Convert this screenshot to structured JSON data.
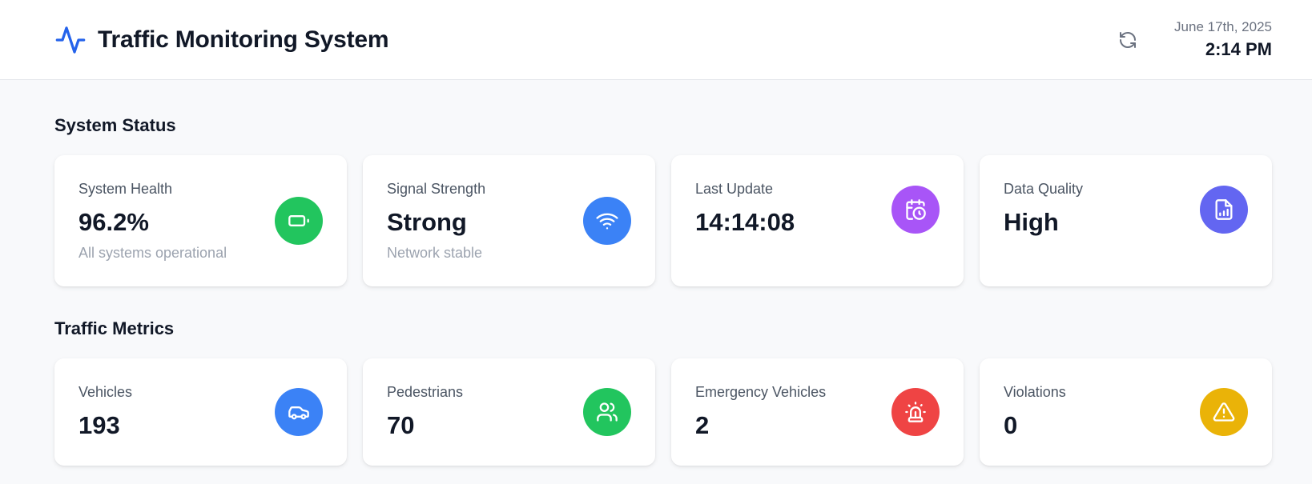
{
  "header": {
    "title": "Traffic Monitoring System",
    "logo_icon": "activity-icon",
    "refresh_icon": "refresh-icon",
    "date": "June 17th, 2025",
    "time": "2:14 PM"
  },
  "system_status": {
    "title": "System Status",
    "cards": [
      {
        "label": "System Health",
        "value": "96.2%",
        "sub": "All systems operational",
        "icon": "battery-icon",
        "color": "#22c55e"
      },
      {
        "label": "Signal Strength",
        "value": "Strong",
        "sub": "Network stable",
        "icon": "wifi-icon",
        "color": "#3b82f6"
      },
      {
        "label": "Last Update",
        "value": "14:14:08",
        "icon": "calendar-clock-icon",
        "color": "#a855f7"
      },
      {
        "label": "Data Quality",
        "value": "High",
        "icon": "file-chart-icon",
        "color": "#6366f1"
      }
    ]
  },
  "traffic_metrics": {
    "title": "Traffic Metrics",
    "cards": [
      {
        "label": "Vehicles",
        "value": "193",
        "icon": "car-icon",
        "color": "#3b82f6"
      },
      {
        "label": "Pedestrians",
        "value": "70",
        "icon": "users-icon",
        "color": "#22c55e"
      },
      {
        "label": "Emergency Vehicles",
        "value": "2",
        "icon": "siren-icon",
        "color": "#ef4444"
      },
      {
        "label": "Violations",
        "value": "0",
        "icon": "alert-triangle-icon",
        "color": "#eab308"
      }
    ]
  }
}
